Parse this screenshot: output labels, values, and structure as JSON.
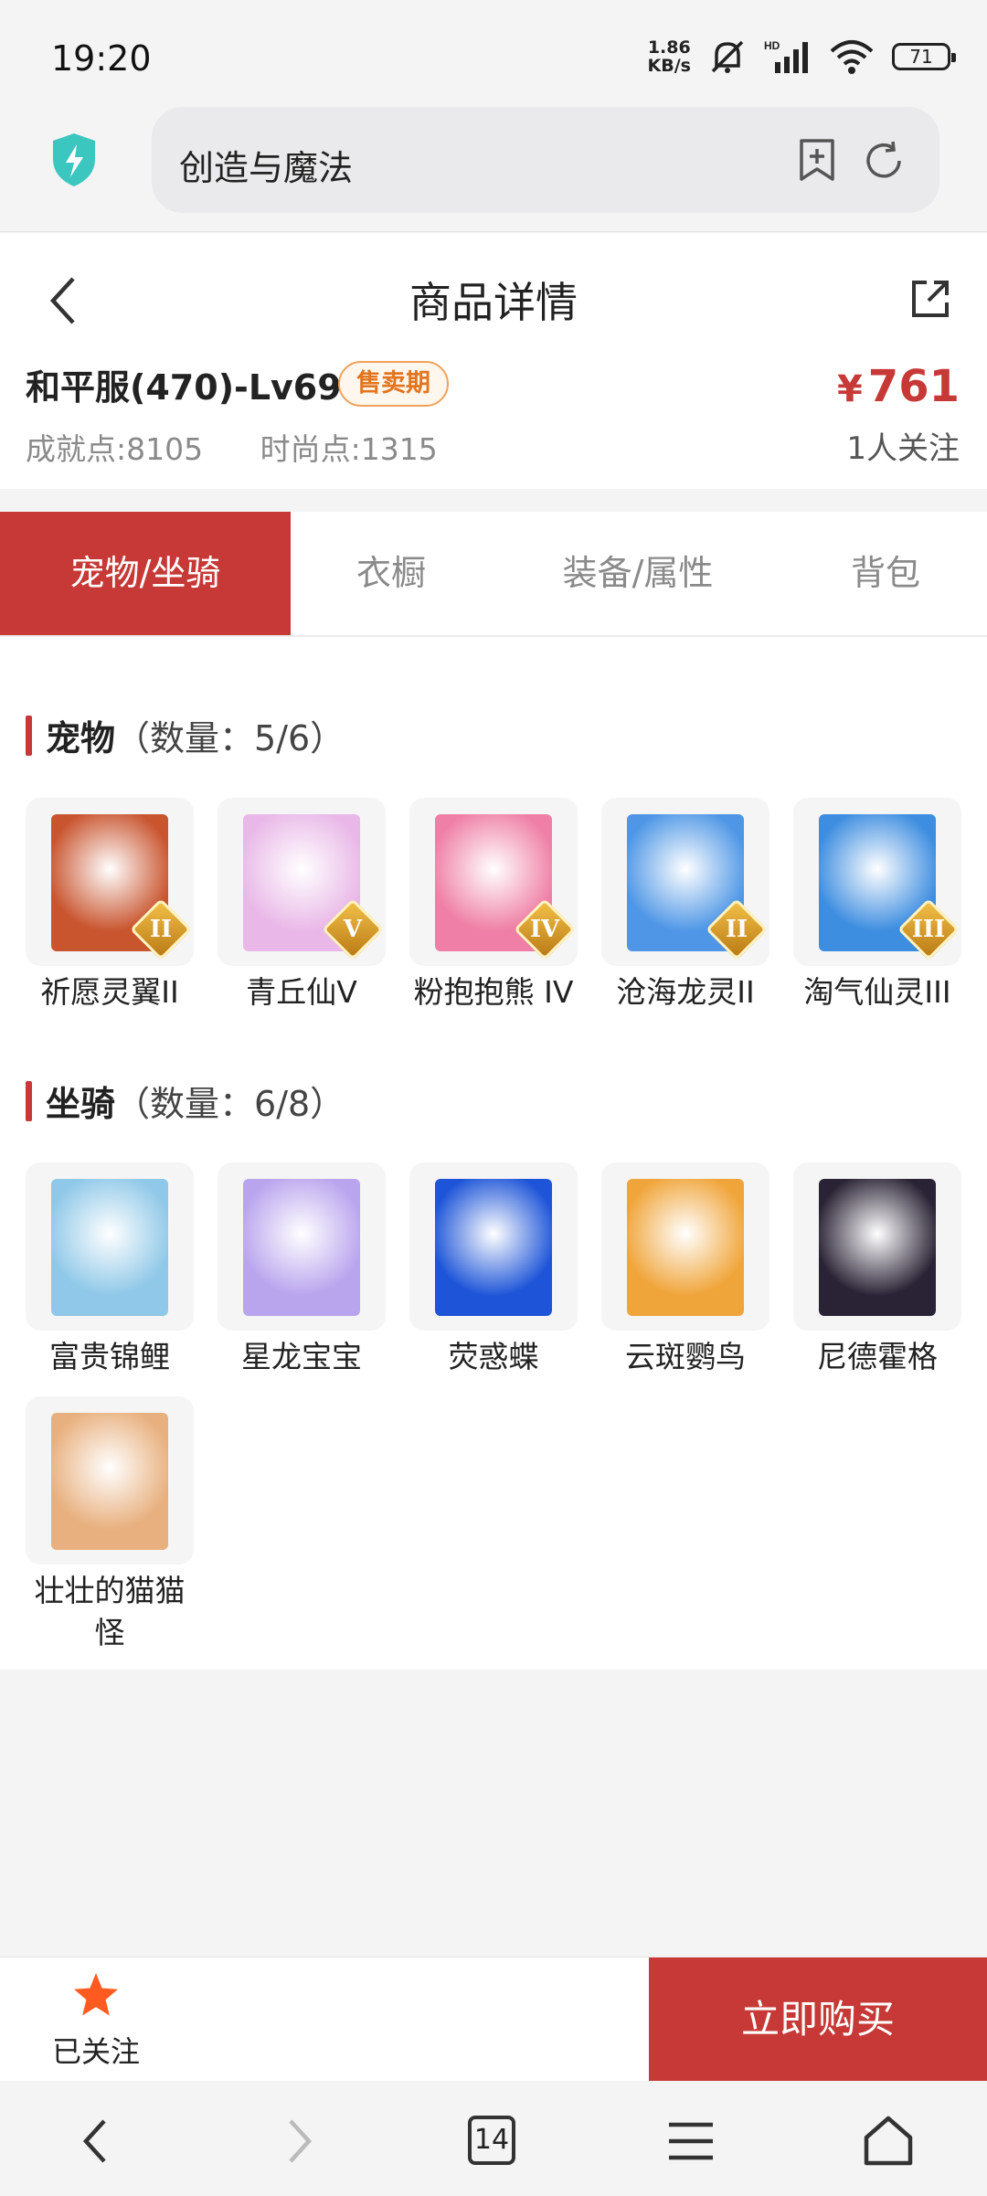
{
  "status_bar": {
    "time": "19:20",
    "net_speed_value": "1.86",
    "net_speed_unit": "KB/s",
    "battery": "71"
  },
  "browser": {
    "url_text": "创造与魔法"
  },
  "header": {
    "title": "商品详情",
    "item_name": "和平服(470)-Lv69",
    "tag": "售卖期",
    "price_symbol": "¥",
    "price": "761",
    "followers": "1人关注",
    "achievement_label": "成就点:",
    "achievement_value": "8105",
    "fashion_label": "时尚点:",
    "fashion_value": "1315"
  },
  "tabs": [
    {
      "label": "宠物/坐骑",
      "active": true
    },
    {
      "label": "衣橱",
      "active": false
    },
    {
      "label": "装备/属性",
      "active": false
    },
    {
      "label": "背包",
      "active": false
    }
  ],
  "pets": {
    "title": "宠物",
    "count_text": "（数量：5/6）",
    "items": [
      {
        "name": "祈愿灵翼II",
        "rank": "II",
        "color": "#c9552f"
      },
      {
        "name": "青丘仙V",
        "rank": "V",
        "color": "#e9b8e8"
      },
      {
        "name": "粉抱抱熊 IV",
        "rank": "IV",
        "color": "#ef7fa6"
      },
      {
        "name": "沧海龙灵II",
        "rank": "II",
        "color": "#4f97e6"
      },
      {
        "name": "淘气仙灵III",
        "rank": "III",
        "color": "#3d8de0"
      }
    ]
  },
  "mounts": {
    "title": "坐骑",
    "count_text": "（数量：6/8）",
    "items": [
      {
        "name": "富贵锦鲤",
        "color": "#8fc8e8"
      },
      {
        "name": "星龙宝宝",
        "color": "#b9a4ee"
      },
      {
        "name": "荧惑蝶",
        "color": "#1e55d8"
      },
      {
        "name": "云斑鹦鸟",
        "color": "#f0a53a"
      },
      {
        "name": "尼德霍格",
        "color": "#2a2335"
      },
      {
        "name": "壮壮的猫猫怪",
        "color": "#e8b07e"
      }
    ]
  },
  "actions": {
    "favorite_label": "已关注",
    "buy_label": "立即购买"
  },
  "nav": {
    "tab_count": "14"
  }
}
